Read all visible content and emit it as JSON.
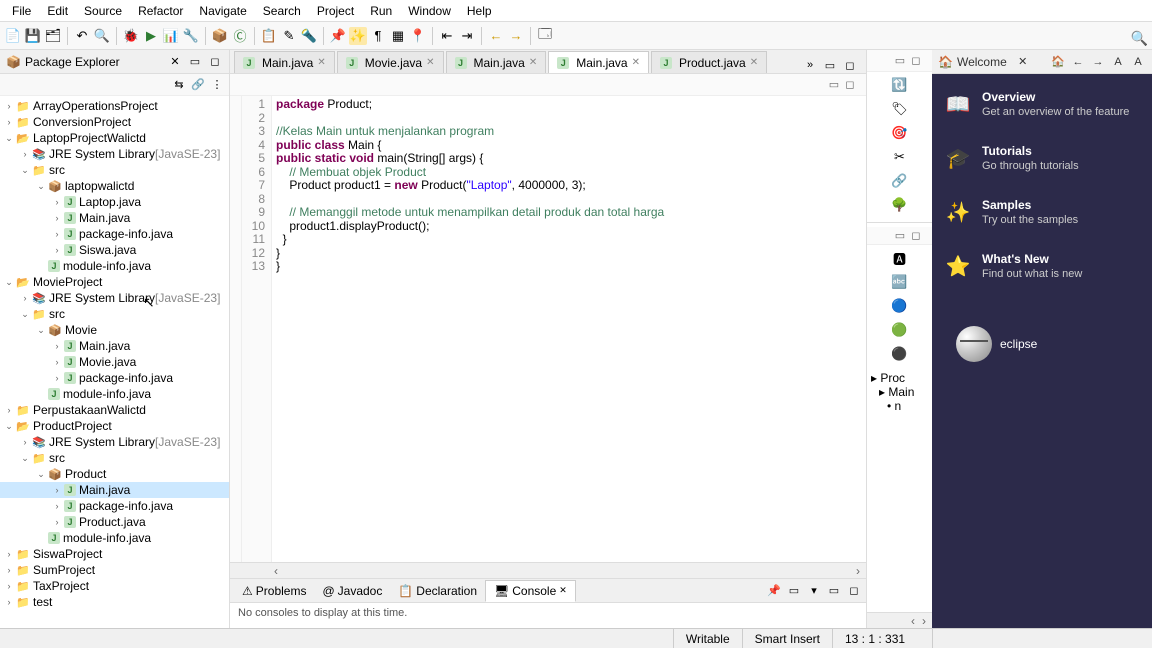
{
  "menu": [
    "File",
    "Edit",
    "Source",
    "Refactor",
    "Navigate",
    "Search",
    "Project",
    "Run",
    "Window",
    "Help"
  ],
  "explorer": {
    "title": "Package Explorer",
    "tree": [
      {
        "l": 0,
        "t": "closed",
        "i": "prj-closed",
        "label": "ArrayOperationsProject"
      },
      {
        "l": 0,
        "t": "closed",
        "i": "prj-closed",
        "label": "ConversionProject"
      },
      {
        "l": 0,
        "t": "open",
        "i": "prj-open",
        "label": "LaptopProjectWalictd"
      },
      {
        "l": 1,
        "t": "closed",
        "i": "lib",
        "label": "JRE System Library",
        "dec": "[JavaSE-23]"
      },
      {
        "l": 1,
        "t": "open",
        "i": "folder",
        "label": "src"
      },
      {
        "l": 2,
        "t": "open",
        "i": "pkg",
        "label": "laptopwalictd"
      },
      {
        "l": 3,
        "t": "closed",
        "i": "jclass",
        "label": "Laptop.java"
      },
      {
        "l": 3,
        "t": "closed",
        "i": "jclass",
        "label": "Main.java"
      },
      {
        "l": 3,
        "t": "closed",
        "i": "jclass",
        "label": "package-info.java"
      },
      {
        "l": 3,
        "t": "closed",
        "i": "jclass",
        "label": "Siswa.java"
      },
      {
        "l": 2,
        "t": "none",
        "i": "jclass",
        "label": "module-info.java"
      },
      {
        "l": 0,
        "t": "open",
        "i": "prj-open",
        "label": "MovieProject"
      },
      {
        "l": 1,
        "t": "closed",
        "i": "lib",
        "label": "JRE System Library",
        "dec": "[JavaSE-23]"
      },
      {
        "l": 1,
        "t": "open",
        "i": "folder",
        "label": "src"
      },
      {
        "l": 2,
        "t": "open",
        "i": "pkg",
        "label": "Movie"
      },
      {
        "l": 3,
        "t": "closed",
        "i": "jclass",
        "label": "Main.java"
      },
      {
        "l": 3,
        "t": "closed",
        "i": "jclass",
        "label": "Movie.java"
      },
      {
        "l": 3,
        "t": "closed",
        "i": "jclass",
        "label": "package-info.java"
      },
      {
        "l": 2,
        "t": "none",
        "i": "jclass",
        "label": "module-info.java"
      },
      {
        "l": 0,
        "t": "closed",
        "i": "prj-closed",
        "label": "PerpustakaanWalictd"
      },
      {
        "l": 0,
        "t": "open",
        "i": "prj-open",
        "label": "ProductProject"
      },
      {
        "l": 1,
        "t": "closed",
        "i": "lib",
        "label": "JRE System Library",
        "dec": "[JavaSE-23]"
      },
      {
        "l": 1,
        "t": "open",
        "i": "folder",
        "label": "src"
      },
      {
        "l": 2,
        "t": "open",
        "i": "pkg",
        "label": "Product"
      },
      {
        "l": 3,
        "t": "closed",
        "i": "jclass",
        "label": "Main.java",
        "selected": true
      },
      {
        "l": 3,
        "t": "closed",
        "i": "jclass",
        "label": "package-info.java"
      },
      {
        "l": 3,
        "t": "closed",
        "i": "jclass",
        "label": "Product.java"
      },
      {
        "l": 2,
        "t": "none",
        "i": "jclass",
        "label": "module-info.java"
      },
      {
        "l": 0,
        "t": "closed",
        "i": "prj-closed",
        "label": "SiswaProject"
      },
      {
        "l": 0,
        "t": "closed",
        "i": "prj-closed",
        "label": "SumProject"
      },
      {
        "l": 0,
        "t": "closed",
        "i": "prj-closed",
        "label": "TaxProject"
      },
      {
        "l": 0,
        "t": "closed",
        "i": "prj-closed",
        "label": "test"
      }
    ]
  },
  "tabs": [
    {
      "label": "Main.java"
    },
    {
      "label": "Movie.java"
    },
    {
      "label": "Main.java"
    },
    {
      "label": "Main.java",
      "active": true
    },
    {
      "label": "Product.java"
    }
  ],
  "tabs_overflow": "»",
  "code": {
    "lines": [
      {
        "n": 1,
        "html": "<span class='kw'>package</span> Product;"
      },
      {
        "n": 2,
        "html": ""
      },
      {
        "n": 3,
        "html": "<span class='cm'>//Kelas Main untuk menjalankan program</span>"
      },
      {
        "n": 4,
        "html": "<span class='kw'>public class</span> Main {"
      },
      {
        "n": 5,
        "html": "<span class='kw'>public static void</span> main(String[] args) {"
      },
      {
        "n": 6,
        "html": "    <span class='cm'>// Membuat objek Product</span>"
      },
      {
        "n": 7,
        "html": "    Product product1 = <span class='kw'>new</span> Product(<span class='str'>\"Laptop\"</span>, 4000000, 3);"
      },
      {
        "n": 8,
        "html": ""
      },
      {
        "n": 9,
        "html": "    <span class='cm'>// Memanggil metode untuk menampilkan detail produk dan total harga</span>"
      },
      {
        "n": 10,
        "html": "    product1.displayProduct();"
      },
      {
        "n": 11,
        "html": "  }"
      },
      {
        "n": 12,
        "html": "}"
      },
      {
        "n": 13,
        "html": "}"
      }
    ]
  },
  "bottom": {
    "tabs": [
      "Problems",
      "Javadoc",
      "Declaration",
      "Console"
    ],
    "active": "Console",
    "console_msg": "No consoles to display at this time."
  },
  "outline": {
    "items": [
      "Proc",
      "Main",
      "n"
    ]
  },
  "welcome": {
    "title": "Welcome",
    "cards": [
      {
        "icon": "📖",
        "title": "Overview",
        "desc": "Get an overview of the feature"
      },
      {
        "icon": "🎓",
        "title": "Tutorials",
        "desc": "Go through tutorials"
      },
      {
        "icon": "✨",
        "title": "Samples",
        "desc": "Try out the samples"
      },
      {
        "icon": "⭐",
        "title": "What's New",
        "desc": "Find out what is new"
      }
    ],
    "logo": "eclipse"
  },
  "status": {
    "writable": "Writable",
    "insert": "Smart Insert",
    "pos": "13 : 1 : 331"
  }
}
